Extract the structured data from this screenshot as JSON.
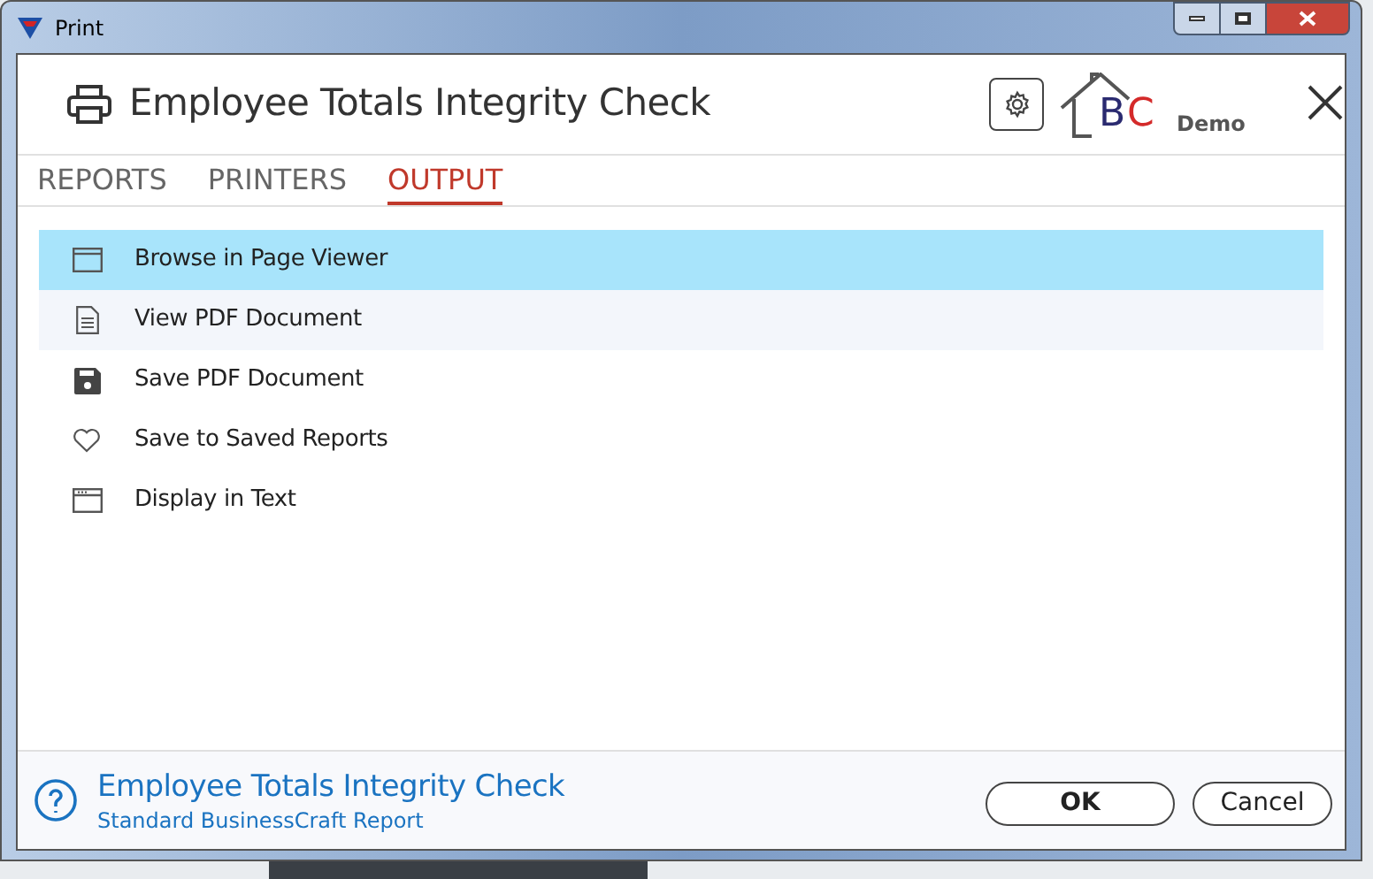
{
  "window": {
    "title": "Print"
  },
  "header": {
    "title": "Employee Totals Integrity Check",
    "logo_letters": [
      "B",
      "C"
    ],
    "logo_text": "Demo"
  },
  "tabs": [
    {
      "label": "REPORTS",
      "selected": false
    },
    {
      "label": "PRINTERS",
      "selected": false
    },
    {
      "label": "OUTPUT",
      "selected": true
    }
  ],
  "output_options": [
    {
      "label": "Browse in Page Viewer",
      "kind": "browser",
      "selected": true,
      "hovered": false
    },
    {
      "label": "View PDF Document",
      "kind": "document",
      "selected": false,
      "hovered": true
    },
    {
      "label": "Save PDF Document",
      "kind": "save",
      "selected": false,
      "hovered": false
    },
    {
      "label": "Save to Saved Reports",
      "kind": "heart",
      "selected": false,
      "hovered": false
    },
    {
      "label": "Display in Text",
      "kind": "text-window",
      "selected": false,
      "hovered": false
    }
  ],
  "footer": {
    "title": "Employee Totals Integrity Check",
    "subtitle": "Standard BusinessCraft Report"
  },
  "buttons": [
    {
      "label": "OK",
      "kind": "primary"
    },
    {
      "label": "Cancel",
      "kind": "secondary"
    }
  ]
}
